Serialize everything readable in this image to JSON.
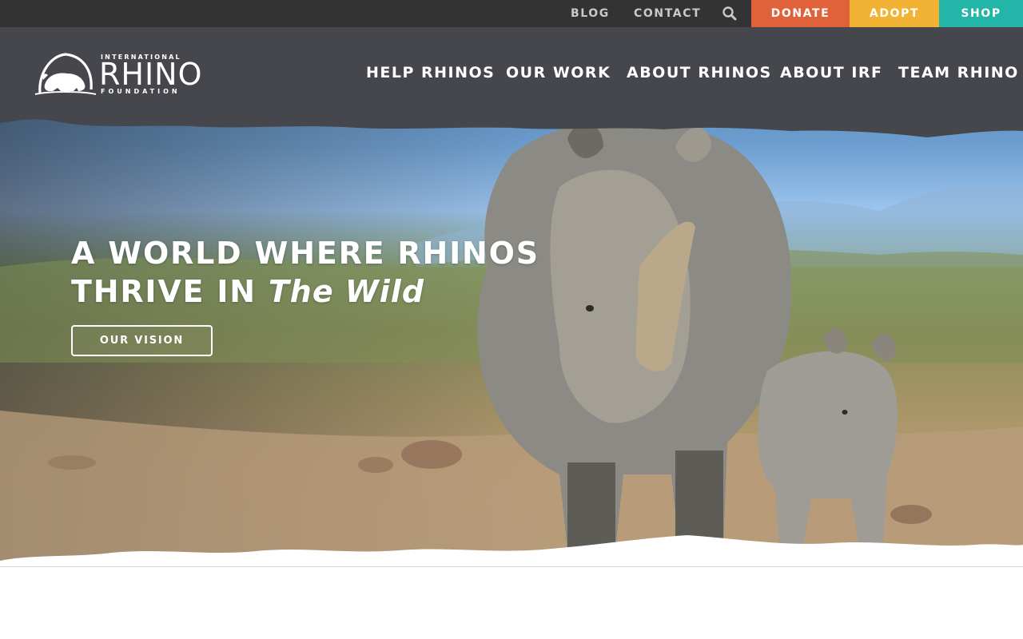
{
  "utility_nav": {
    "blog": "BLOG",
    "contact": "CONTACT",
    "search_icon": "search-icon"
  },
  "cta_buttons": {
    "donate": {
      "label": "DONATE",
      "color": "#e0623a"
    },
    "adopt": {
      "label": "ADOPT",
      "color": "#f2b233"
    },
    "shop": {
      "label": "SHOP",
      "color": "#22b5a8"
    }
  },
  "logo": {
    "line1": "INTERNATIONAL",
    "line2": "RHINO",
    "line3": "FOUNDATION",
    "icon": "rhino-logo-icon"
  },
  "main_nav": {
    "items": [
      {
        "label": "HELP RHINOS"
      },
      {
        "label": "OUR WORK"
      },
      {
        "label": "ABOUT RHINOS"
      },
      {
        "label": "ABOUT IRF"
      },
      {
        "label": "TEAM RHINO"
      }
    ]
  },
  "hero": {
    "title_line1": "A WORLD WHERE RHINOS",
    "title_line2_prefix": "THRIVE IN ",
    "title_line2_accent": "The Wild",
    "button_label": "OUR VISION"
  },
  "colors": {
    "utility_bar": "#333333",
    "header_band": "#46474d"
  }
}
